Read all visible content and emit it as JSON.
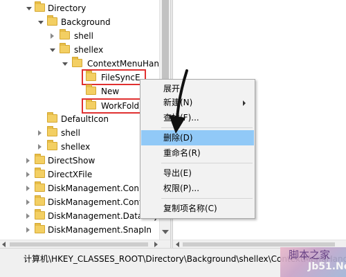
{
  "tree": {
    "items": [
      {
        "label": "Directory",
        "expander": "expanded"
      },
      {
        "label": "Background",
        "expander": "expanded"
      },
      {
        "label": "shell",
        "expander": "collapsed"
      },
      {
        "label": "shellex",
        "expander": "expanded"
      },
      {
        "label": "ContextMenuHand",
        "expander": "expanded"
      },
      {
        "label": "FileSyncE",
        "expander": "none",
        "selected": true,
        "highlighted": true
      },
      {
        "label": "New",
        "expander": "none"
      },
      {
        "label": "WorkFold",
        "expander": "none",
        "highlighted": true
      },
      {
        "label": "DefaultIcon",
        "expander": "none"
      },
      {
        "label": "shell",
        "expander": "collapsed"
      },
      {
        "label": "shellex",
        "expander": "collapsed"
      },
      {
        "label": "DirectShow",
        "expander": "collapsed"
      },
      {
        "label": "DirectXFile",
        "expander": "collapsed"
      },
      {
        "label": "DiskManagement.Conn",
        "expander": "collapsed"
      },
      {
        "label": "DiskManagement.Cont",
        "expander": "collapsed"
      },
      {
        "label": "DiskManagement.DataObje",
        "expander": "collapsed"
      },
      {
        "label": "DiskManagement.SnapIn",
        "expander": "collapsed"
      }
    ]
  },
  "context_menu": {
    "items": [
      {
        "label": "展开"
      },
      {
        "label": "新建(N)",
        "submenu": true
      },
      {
        "label": "查找(F)..."
      },
      {
        "label": "删除(D)",
        "selected": true
      },
      {
        "label": "重命名(R)"
      },
      {
        "label": "导出(E)"
      },
      {
        "label": "权限(P)..."
      },
      {
        "label": "复制项名称(C)"
      }
    ]
  },
  "status": {
    "path": "计算机\\HKEY_CLASSES_ROOT\\Directory\\Background\\shellex\\ContextMenuHandle"
  },
  "watermark": {
    "text": "脚本之家",
    "sub": "Jb51.Net"
  },
  "colors": {
    "highlight_border": "#e03030",
    "menu_selected": "#91c9f7",
    "folder": "#f3cf63"
  }
}
